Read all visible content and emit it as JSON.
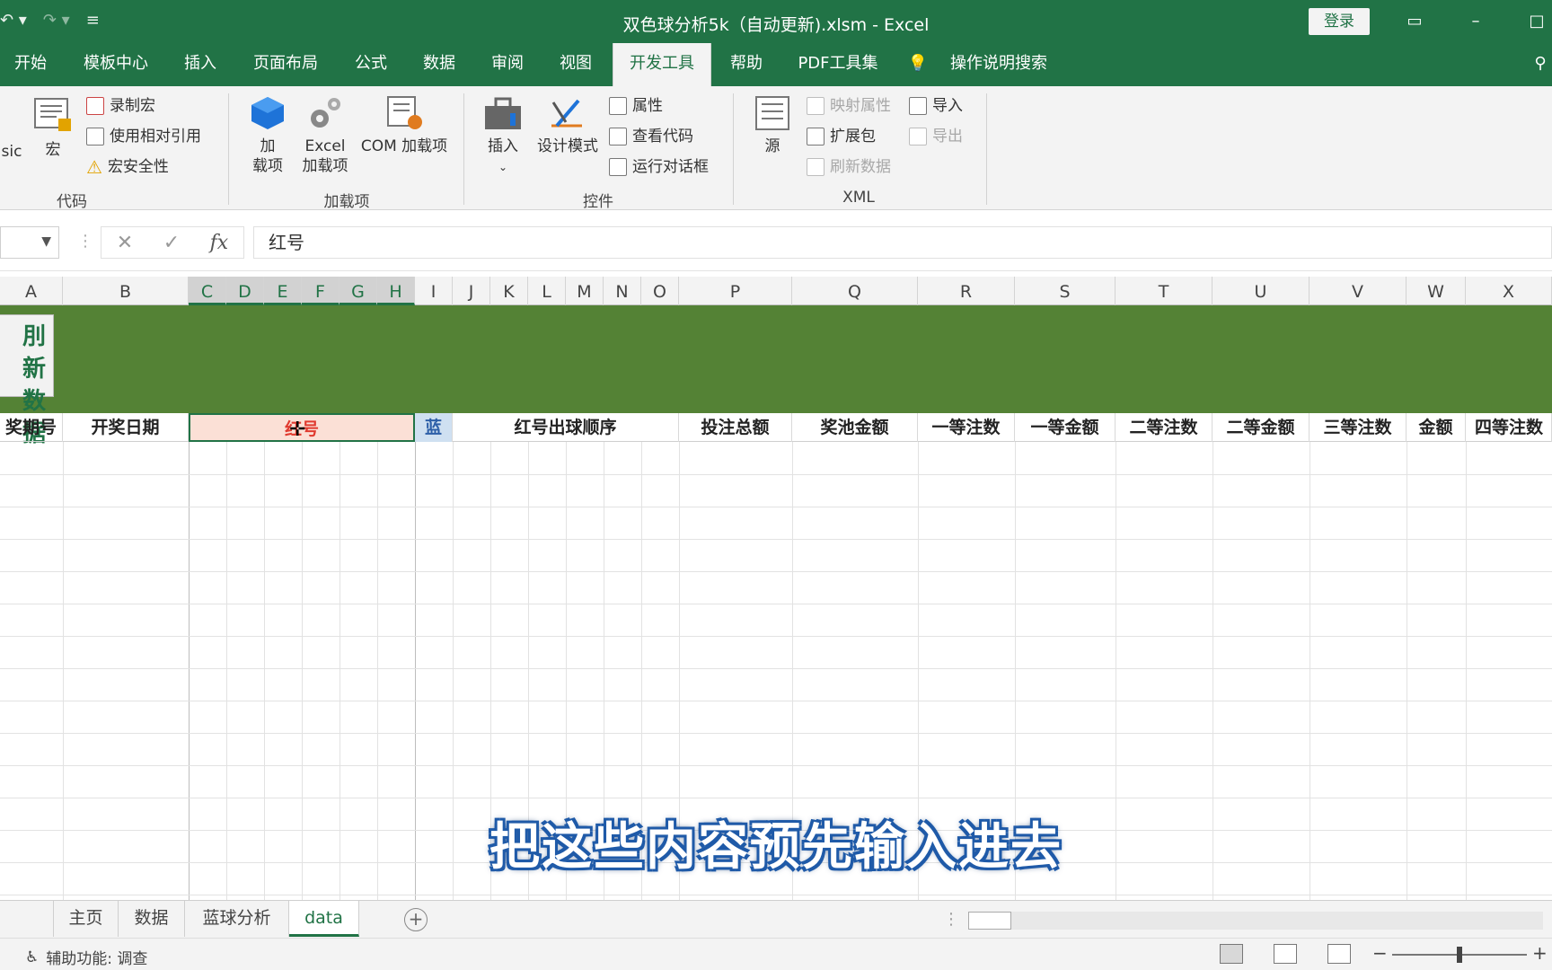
{
  "titlebar": {
    "filename": "双色球分析5k（自动更新).xlsm",
    "separator": "-",
    "app": "Excel",
    "login": "登录"
  },
  "tabs": [
    "开始",
    "模板中心",
    "插入",
    "页面布局",
    "公式",
    "数据",
    "审阅",
    "视图",
    "开发工具",
    "帮助",
    "PDF工具集",
    "操作说明搜索"
  ],
  "active_tab": "开发工具",
  "ribbon": {
    "code": {
      "label": "代码",
      "basic_partial": "sic",
      "macros": "宏",
      "record_macro": "录制宏",
      "relative_ref": "使用相对引用",
      "macro_security": "宏安全性"
    },
    "addins": {
      "label": "加载项",
      "addins_line1": "加",
      "addins_line2": "载项",
      "excel_line1": "Excel",
      "excel_line2": "加载项",
      "com_line1": "COM 加载项"
    },
    "controls": {
      "label": "控件",
      "insert": "插入",
      "design_mode": "设计模式",
      "properties": "属性",
      "view_code": "查看代码",
      "run_dialog": "运行对话框"
    },
    "xml": {
      "label": "XML",
      "source": "源",
      "map_properties": "映射属性",
      "expansion_packs": "扩展包",
      "refresh_data": "刷新数据",
      "import": "导入",
      "export": "导出"
    }
  },
  "formula_bar": {
    "cancel": "✕",
    "enter": "✓",
    "fx": "fx",
    "value": "红号"
  },
  "columns": [
    "A",
    "B",
    "C",
    "D",
    "E",
    "F",
    "G",
    "H",
    "I",
    "J",
    "K",
    "L",
    "M",
    "N",
    "O",
    "P",
    "Q",
    "R",
    "S",
    "T",
    "U",
    "V",
    "W",
    "X"
  ],
  "refresh_button": {
    "line1": "刷新",
    "line2": "数据",
    "line1_partial": "刖新",
    "line2_partial": "数据"
  },
  "header_row": [
    "奖期号",
    "开奖日期",
    "红号",
    "蓝",
    "红号出球顺序",
    "投注总额",
    "奖池金额",
    "一等注数",
    "一等金额",
    "二等注数",
    "二等金额",
    "三等注数",
    "金额",
    "四等注数"
  ],
  "subtitle": "把这些内容预先输入进去",
  "sheets": [
    "主页",
    "数据",
    "蓝球分析",
    "data"
  ],
  "active_sheet": "data",
  "status": {
    "accessibility": "辅助功能: 调查"
  },
  "colors": {
    "excel_green": "#217346",
    "banner_green": "#548235",
    "red_header_bg": "#fbe0d6",
    "blue_header_bg": "#cfe0f1"
  }
}
